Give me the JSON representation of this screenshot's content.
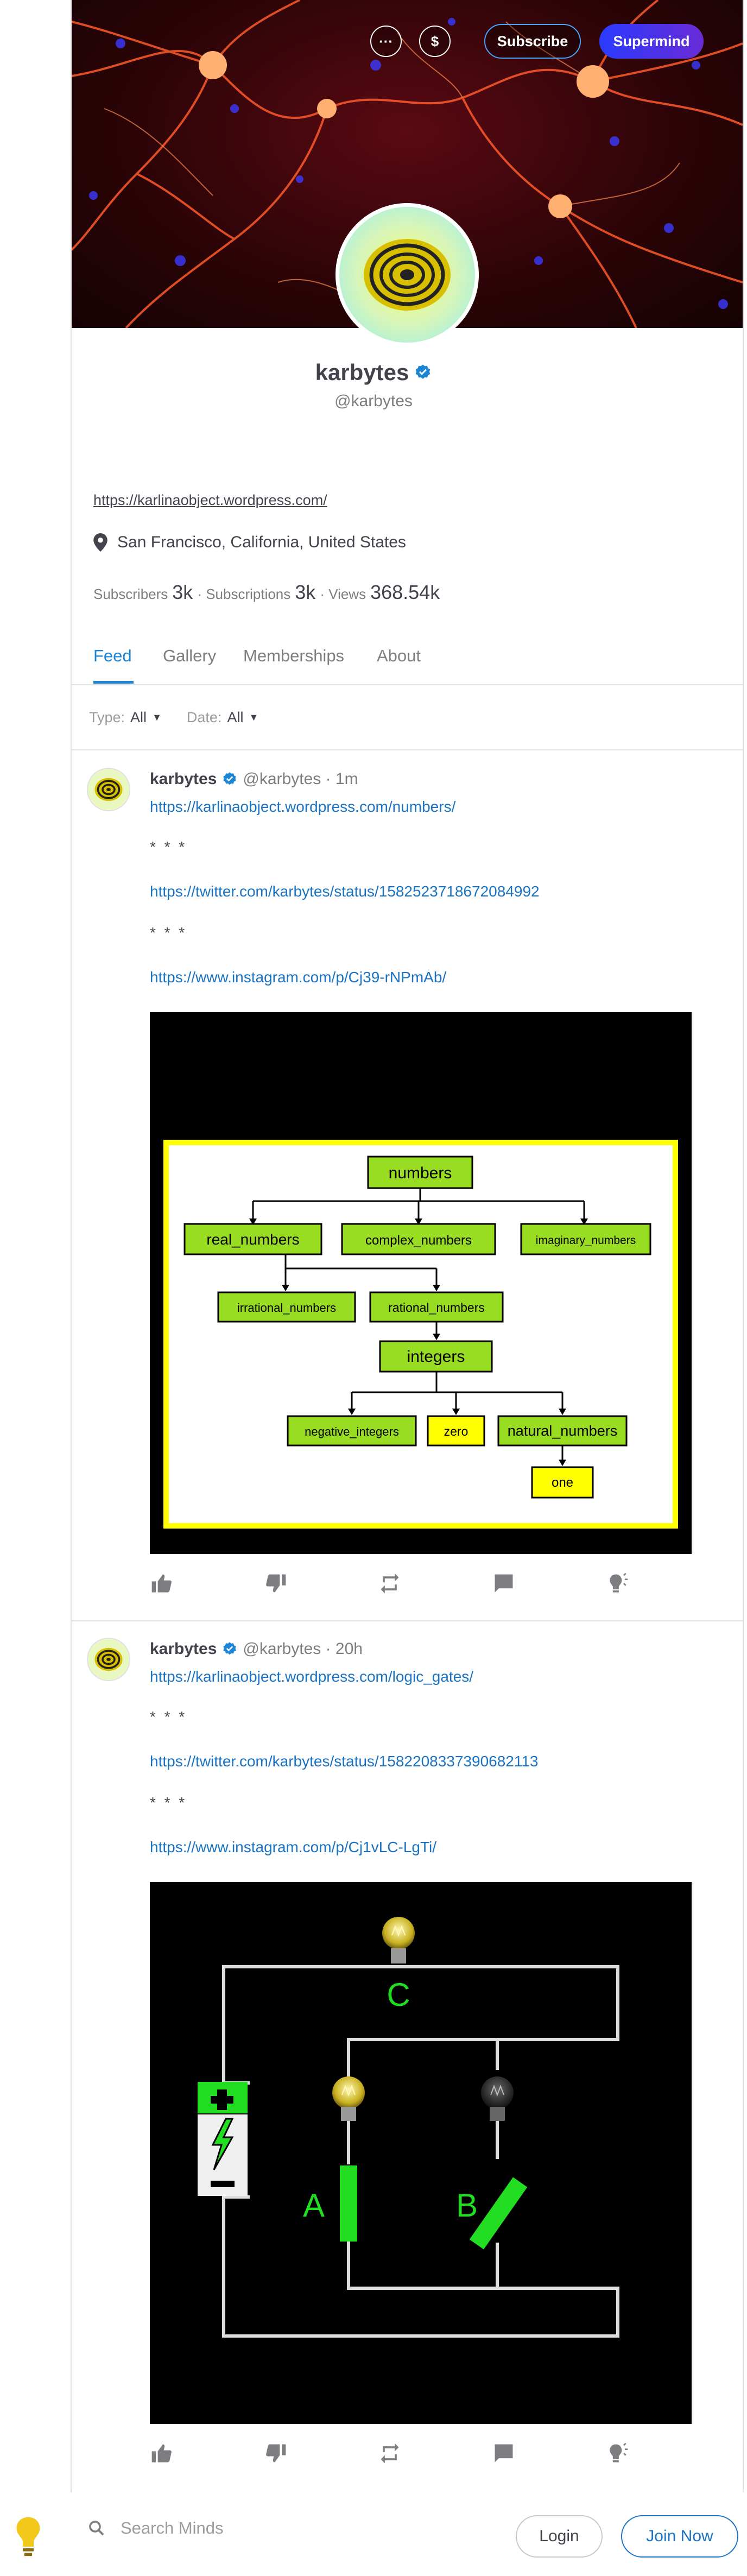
{
  "banner": {
    "more_label": "···",
    "tip_label": "$",
    "subscribe_label": "Subscribe",
    "supermind_label": "Supermind"
  },
  "profile": {
    "name": "karbytes",
    "handle": "@karbytes",
    "website": "https://karlinaobject.wordpress.com/",
    "location": "San Francisco, California, United States",
    "stats": {
      "subscribers_label": "Subscribers",
      "subscribers_value": "3k",
      "subscriptions_label": "· Subscriptions",
      "subscriptions_value": "3k",
      "views_label": "· Views",
      "views_value": "368.54k"
    }
  },
  "tabs": [
    {
      "label": "Feed",
      "active": true
    },
    {
      "label": "Gallery",
      "active": false
    },
    {
      "label": "Memberships",
      "active": false
    },
    {
      "label": "About",
      "active": false
    }
  ],
  "filters": {
    "type_label": "Type:",
    "type_value": "All",
    "date_label": "Date:",
    "date_value": "All"
  },
  "posts": [
    {
      "name": "karbytes",
      "meta": "@karbytes · 1m",
      "lines": [
        "https://karlinaobject.wordpress.com/numbers/",
        "* * *",
        "https://twitter.com/karbytes/status/1582523718672084992",
        "* * *",
        "https://www.instagram.com/p/Cj39-rNPmAb/"
      ],
      "diagram": {
        "root": "numbers",
        "level1": [
          "real_numbers",
          "complex_numbers",
          "imaginary_numbers"
        ],
        "level2": [
          "irrational_numbers",
          "rational_numbers"
        ],
        "level3": "integers",
        "level4": [
          "negative_integers",
          "zero",
          "natural_numbers"
        ],
        "level5": "one"
      }
    },
    {
      "name": "karbytes",
      "meta": "@karbytes · 20h",
      "lines": [
        "https://karlinaobject.wordpress.com/logic_gates/",
        "* * *",
        "https://twitter.com/karbytes/status/1582208337390682113",
        "* * *",
        "https://www.instagram.com/p/Cj1vLC-LgTi/"
      ],
      "circuit": {
        "label_a": "A",
        "label_b": "B",
        "label_c": "C"
      }
    }
  ],
  "footer": {
    "search_placeholder": "Search Minds",
    "login_label": "Login",
    "join_label": "Join Now"
  },
  "colors": {
    "accent": "#1b74c3",
    "diagram_green": "#99dd22",
    "diagram_yellow": "#ffff00",
    "circuit_green": "#22dd22"
  }
}
